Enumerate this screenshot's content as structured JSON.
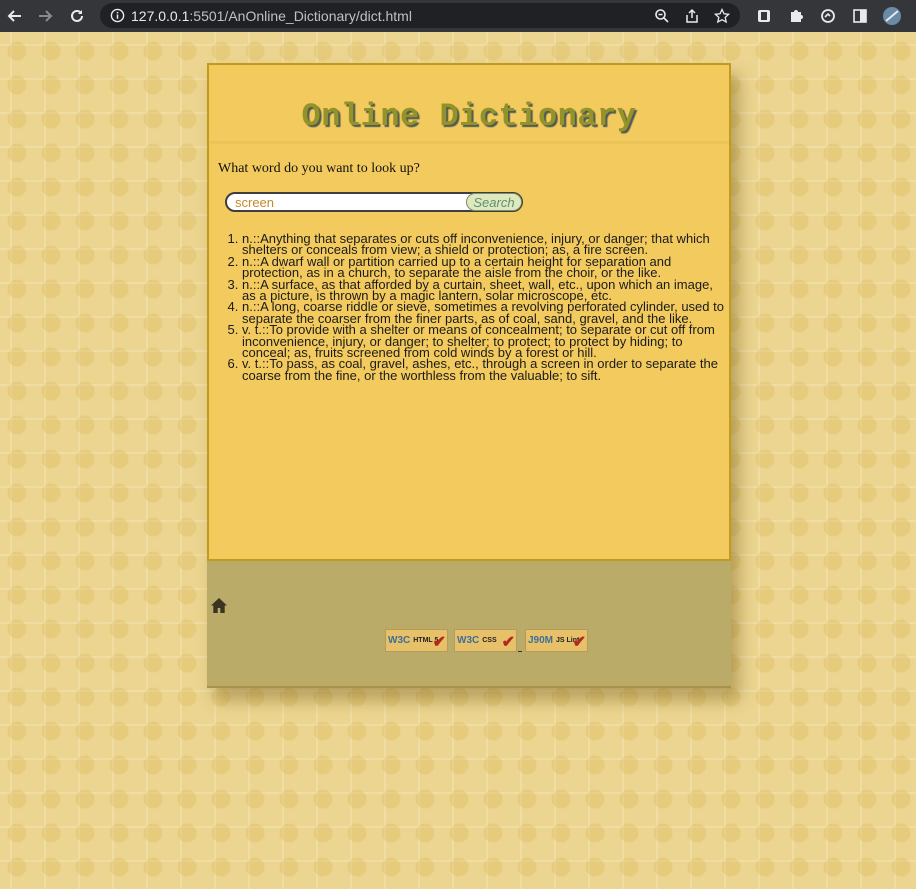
{
  "browser": {
    "url_host": "127.0.0.1",
    "url_rest": ":5501/AnOnline_Dictionary/dict.html"
  },
  "page": {
    "title": "Online Dictionary",
    "prompt": "What word do you want to look up?",
    "search": {
      "value": "screen",
      "button_label": "Search"
    },
    "definitions": [
      "n.::Anything that separates or cuts off inconvenience, injury, or danger; that which shelters or conceals from view; a shield or protection; as, a fire screen.",
      "n.::A dwarf wall or partition carried up to a certain height for separation and protection, as in a church, to separate the aisle from the choir, or the like.",
      "n.::A surface, as that afforded by a curtain, sheet, wall, etc., upon which an image, as a picture, is thrown by a magic lantern, solar microscope, etc.",
      "n.::A long, coarse riddle or sieve, sometimes a revolving perforated cylinder, used to separate the coarser from the finer parts, as of coal, sand, gravel, and the like.",
      "v. t.::To provide with a shelter or means of concealment; to separate or cut off from inconvenience, injury, or danger; to shelter; to protect; to protect by hiding; to conceal; as, fruits screened from cold winds by a forest or hill.",
      "v. t.::To pass, as coal, gravel, ashes, etc., through a screen in order to separate the coarse from the fine, or the worthless from the valuable; to sift."
    ],
    "footer": {
      "badges": [
        {
          "logo": "W3C",
          "label": "HTML 5"
        },
        {
          "logo": "W3C",
          "label": "CSS"
        },
        {
          "logo": "J90M",
          "label": "JS Lint"
        }
      ]
    }
  },
  "icons": [
    "back-icon",
    "forward-icon",
    "reload-icon",
    "info-icon",
    "zoom-icon",
    "share-icon",
    "star-icon",
    "extension-icon",
    "home-icon"
  ]
}
